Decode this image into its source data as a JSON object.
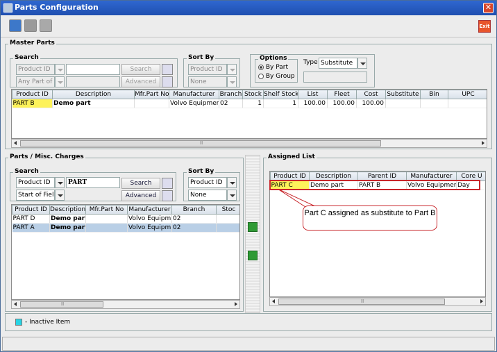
{
  "window": {
    "title": "Parts Configuration",
    "close_label": "✕",
    "exit_label": "Exit"
  },
  "toolbar": {
    "buttons": [
      "save-icon",
      "link-icon",
      "copy-icon"
    ]
  },
  "master": {
    "title": "Master Parts",
    "search": {
      "title": "Search",
      "field": "Product ID",
      "mode": "Any Part of ...",
      "value": "",
      "search_label": "Search",
      "advanced_label": "Advanced"
    },
    "sortby": {
      "title": "Sort By",
      "primary": "Product ID",
      "secondary": "None"
    },
    "options": {
      "title": "Options",
      "by_part": "By Part",
      "by_group": "By Group",
      "type_label": "Type",
      "type_value": "Substitute"
    },
    "columns": [
      "Product ID",
      "Description",
      "Mfr.Part No",
      "Manufacturer",
      "Branch",
      "Stock",
      "Shelf Stock",
      "List",
      "Fleet",
      "Cost",
      "Substitute",
      "Bin",
      "UPC"
    ],
    "rows": [
      [
        "PART B",
        "Demo part",
        "",
        "Volvo Equipment",
        "02",
        "1",
        "1",
        "100.00",
        "100.00",
        "100.00",
        "",
        "",
        ""
      ]
    ],
    "scroll_mark": "II"
  },
  "parts": {
    "title": "Parts / Misc. Charges",
    "search": {
      "title": "Search",
      "field": "Product ID",
      "mode": "Start of Field",
      "value": "PART",
      "search_label": "Search",
      "advanced_label": "Advanced"
    },
    "sortby": {
      "title": "Sort By",
      "primary": "Product ID",
      "secondary": "None"
    },
    "columns": [
      "Product ID",
      "Description",
      "Mfr.Part No",
      "Manufacturer",
      "Branch",
      "Stoc"
    ],
    "rows": [
      [
        "PART D",
        "Demo part",
        "",
        "Volvo Equipm...",
        "02",
        ""
      ],
      [
        "PART A",
        "Demo part",
        "",
        "Volvo Equipm...",
        "02",
        ""
      ]
    ],
    "scroll_mark": "II"
  },
  "assigned": {
    "title": "Assigned List",
    "columns": [
      "Product ID",
      "Description",
      "Parent ID",
      "Manufacturer",
      "Core U"
    ],
    "rows": [
      [
        "PART C",
        "Demo part",
        "PART B",
        "Volvo Equipment",
        "Day"
      ]
    ],
    "callout": "Part C assigned as substitute to Part B",
    "scroll_mark": "II"
  },
  "legend": {
    "text": "- Inactive Item",
    "color": "#27d3e3"
  }
}
